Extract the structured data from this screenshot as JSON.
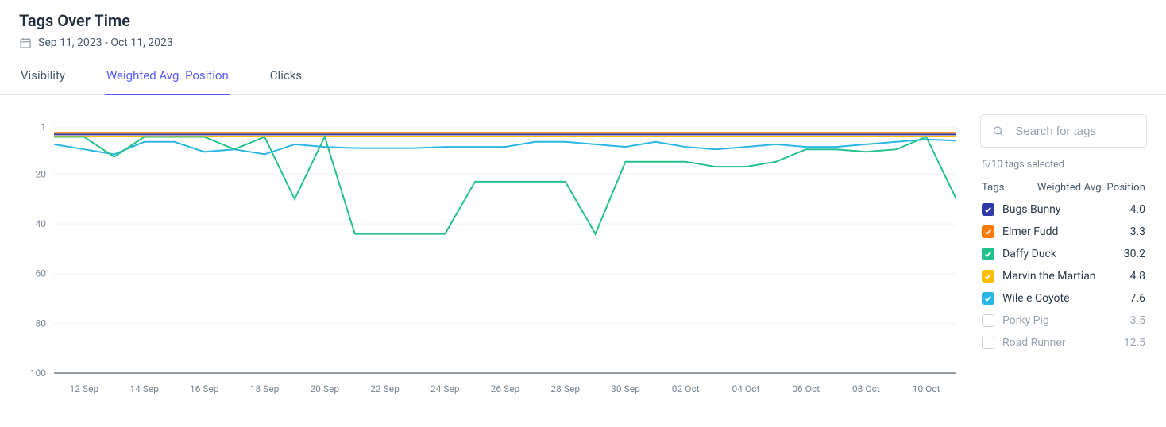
{
  "header": {
    "title": "Tags Over Time",
    "date_range": "Sep 11, 2023 - Oct 11, 2023"
  },
  "tabs": [
    {
      "id": "visibility",
      "label": "Visibility",
      "active": false
    },
    {
      "id": "weighted",
      "label": "Weighted Avg. Position",
      "active": true
    },
    {
      "id": "clicks",
      "label": "Clicks",
      "active": false
    }
  ],
  "search": {
    "placeholder": "Search for tags"
  },
  "selection_status": "5/10 tags selected",
  "legend_header": {
    "col1": "Tags",
    "col2": "Weighted Avg. Position"
  },
  "legend": [
    {
      "name": "Bugs Bunny",
      "value": "4.0",
      "color": "#2f3aa8",
      "checked": true
    },
    {
      "name": "Elmer Fudd",
      "value": "3.3",
      "color": "#ff7a00",
      "checked": true
    },
    {
      "name": "Daffy Duck",
      "value": "30.2",
      "color": "#24c18c",
      "checked": true
    },
    {
      "name": "Marvin the Martian",
      "value": "4.8",
      "color": "#ffbf00",
      "checked": true
    },
    {
      "name": "Wile e Coyote",
      "value": "7.6",
      "color": "#2bb7e5",
      "checked": true
    },
    {
      "name": "Porky Pig",
      "value": "3.5",
      "color": null,
      "checked": false
    },
    {
      "name": "Road Runner",
      "value": "12.5",
      "color": null,
      "checked": false
    }
  ],
  "chart_data": {
    "type": "line",
    "title": "",
    "xlabel": "",
    "ylabel": "",
    "y_ticks": [
      1,
      20,
      40,
      60,
      80,
      100
    ],
    "ylim": [
      1,
      100
    ],
    "y_inverted": true,
    "x": [
      "11 Sep",
      "12 Sep",
      "13 Sep",
      "14 Sep",
      "15 Sep",
      "16 Sep",
      "17 Sep",
      "18 Sep",
      "19 Sep",
      "20 Sep",
      "21 Sep",
      "22 Sep",
      "23 Sep",
      "24 Sep",
      "25 Sep",
      "26 Sep",
      "27 Sep",
      "28 Sep",
      "29 Sep",
      "30 Sep",
      "01 Oct",
      "02 Oct",
      "03 Oct",
      "04 Oct",
      "05 Oct",
      "06 Oct",
      "07 Oct",
      "08 Oct",
      "09 Oct",
      "10 Oct",
      "11 Oct"
    ],
    "x_tick_labels": [
      "12 Sep",
      "14 Sep",
      "16 Sep",
      "18 Sep",
      "20 Sep",
      "22 Sep",
      "24 Sep",
      "26 Sep",
      "28 Sep",
      "30 Sep",
      "02 Oct",
      "04 Oct",
      "06 Oct",
      "08 Oct",
      "10 Oct"
    ],
    "series": [
      {
        "name": "Bugs Bunny",
        "color": "#2f3aa8",
        "values": [
          4,
          4,
          4,
          4,
          4,
          4,
          4,
          4,
          4,
          4,
          4,
          4,
          4,
          4,
          4,
          4,
          4,
          4,
          4,
          4,
          4,
          4,
          4,
          4,
          4,
          4,
          4,
          4,
          4,
          4,
          4
        ]
      },
      {
        "name": "Elmer Fudd",
        "color": "#ff7a00",
        "values": [
          3.3,
          3.3,
          3.3,
          3.3,
          3.3,
          3.3,
          3.3,
          3.3,
          3.3,
          3.3,
          3.3,
          3.3,
          3.3,
          3.3,
          3.3,
          3.3,
          3.3,
          3.3,
          3.3,
          3.3,
          3.3,
          3.3,
          3.3,
          3.3,
          3.3,
          3.3,
          3.3,
          3.3,
          3.3,
          3.3,
          3.3
        ]
      },
      {
        "name": "Marvin the Martian",
        "color": "#ffbf00",
        "values": [
          4.8,
          4.8,
          4.8,
          4.8,
          4.8,
          4.8,
          4.8,
          4.8,
          4.8,
          4.8,
          4.8,
          4.8,
          4.8,
          4.8,
          4.8,
          4.8,
          4.8,
          4.8,
          4.8,
          4.8,
          4.8,
          4.8,
          4.8,
          4.8,
          4.8,
          4.8,
          4.8,
          4.8,
          4.8,
          4.8,
          4.8
        ]
      },
      {
        "name": "Wile e Coyote",
        "color": "#2bb7e5",
        "values": [
          8,
          10,
          12,
          7,
          7,
          11,
          10,
          12,
          8,
          9,
          9.5,
          9.5,
          9.5,
          9,
          9,
          9,
          7,
          7,
          8,
          9,
          7,
          9,
          10,
          9,
          8,
          9,
          9,
          8,
          7,
          6,
          6.5
        ]
      },
      {
        "name": "Daffy Duck",
        "color": "#24c18c",
        "values": [
          5,
          5,
          13,
          5,
          5,
          5,
          10,
          5,
          30,
          5,
          44,
          44,
          44,
          44,
          23,
          23,
          23,
          23,
          44,
          15,
          15,
          15,
          17,
          17,
          15,
          10,
          10,
          11,
          10,
          5,
          30
        ]
      }
    ]
  }
}
